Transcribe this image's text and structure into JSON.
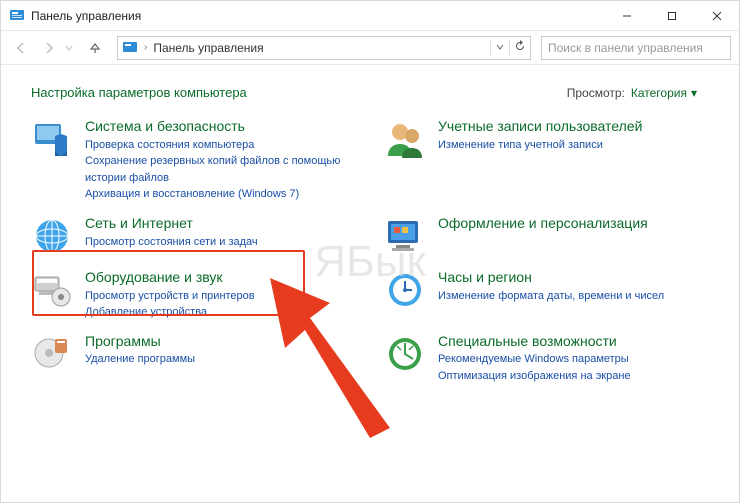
{
  "titlebar": {
    "title": "Панель управления"
  },
  "nav": {
    "breadcrumb": "Панель управления",
    "search_placeholder": "Поиск в панели управления"
  },
  "content": {
    "heading": "Настройка параметров компьютера",
    "view_label": "Просмотр:",
    "view_value": "Категория"
  },
  "categories": {
    "system": {
      "title": "Система и безопасность",
      "links": [
        "Проверка состояния компьютера",
        "Сохранение резервных копий файлов с помощью истории файлов",
        "Архивация и восстановление (Windows 7)"
      ]
    },
    "accounts": {
      "title": "Учетные записи пользователей",
      "links": [
        "Изменение типа учетной записи"
      ]
    },
    "network": {
      "title": "Сеть и Интернет",
      "links": [
        "Просмотр состояния сети и задач"
      ]
    },
    "appearance": {
      "title": "Оформление и персонализация",
      "links": []
    },
    "hardware": {
      "title": "Оборудование и звук",
      "links": [
        "Просмотр устройств и принтеров",
        "Добавление устройства"
      ]
    },
    "clock": {
      "title": "Часы и регион",
      "links": [
        "Изменение формата даты, времени и чисел"
      ]
    },
    "programs": {
      "title": "Программы",
      "links": [
        "Удаление программы"
      ]
    },
    "ease": {
      "title": "Специальные возможности",
      "links": [
        "Рекомендуемые Windows параметры",
        "Оптимизация изображения на экране"
      ]
    }
  },
  "watermark": "ЯБык"
}
